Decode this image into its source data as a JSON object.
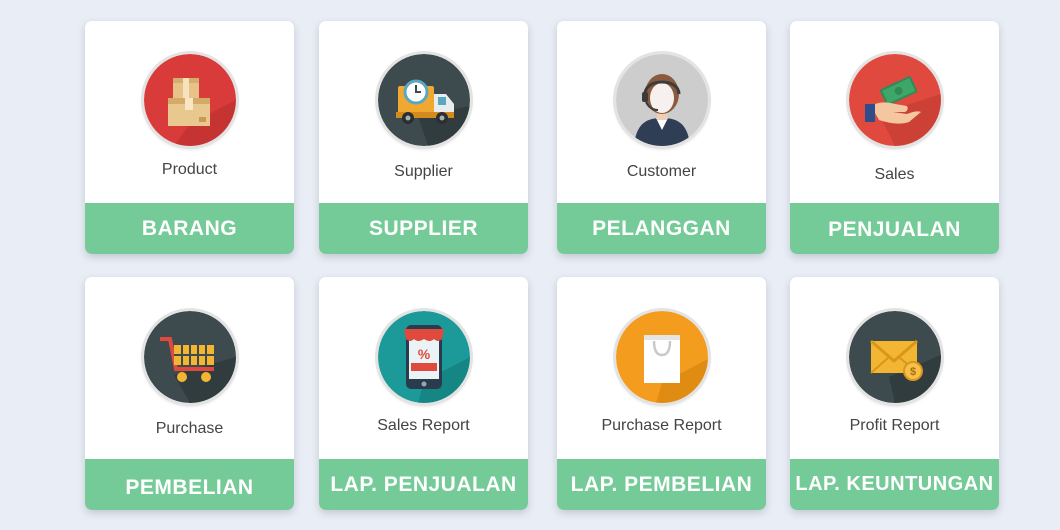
{
  "colors": {
    "background": "#e9edf5",
    "card": "#ffffff",
    "banner": "#75cb98",
    "banner_text": "#ffffff",
    "caption_text": "#444444"
  },
  "menu": [
    {
      "caption": "Product",
      "label": "BARANG",
      "icon": "boxes-icon",
      "icon_bg": "#d93a3a"
    },
    {
      "caption": "Supplier",
      "label": "SUPPLIER",
      "icon": "delivery-truck-icon",
      "icon_bg": "#3d4a4e"
    },
    {
      "caption": "Customer",
      "label": "PELANGGAN",
      "icon": "customer-agent-icon",
      "icon_bg": "#cdcdcd"
    },
    {
      "caption": "Sales",
      "label": "PENJUALAN",
      "icon": "money-hand-icon",
      "icon_bg": "#e04a3e"
    },
    {
      "caption": "Purchase",
      "label": "PEMBELIAN",
      "icon": "shopping-cart-icon",
      "icon_bg": "#3d4a4e"
    },
    {
      "caption": "Sales Report",
      "label": "LAP. PENJUALAN",
      "icon": "discount-phone-icon",
      "icon_bg": "#1c9a99"
    },
    {
      "caption": "Purchase Report",
      "label": "LAP. PEMBELIAN",
      "icon": "shopping-bag-icon",
      "icon_bg": "#f39c1d"
    },
    {
      "caption": "Profit Report",
      "label": "LAP. KEUNTUNGAN",
      "icon": "envelope-coin-icon",
      "icon_bg": "#3d4a4e"
    }
  ]
}
